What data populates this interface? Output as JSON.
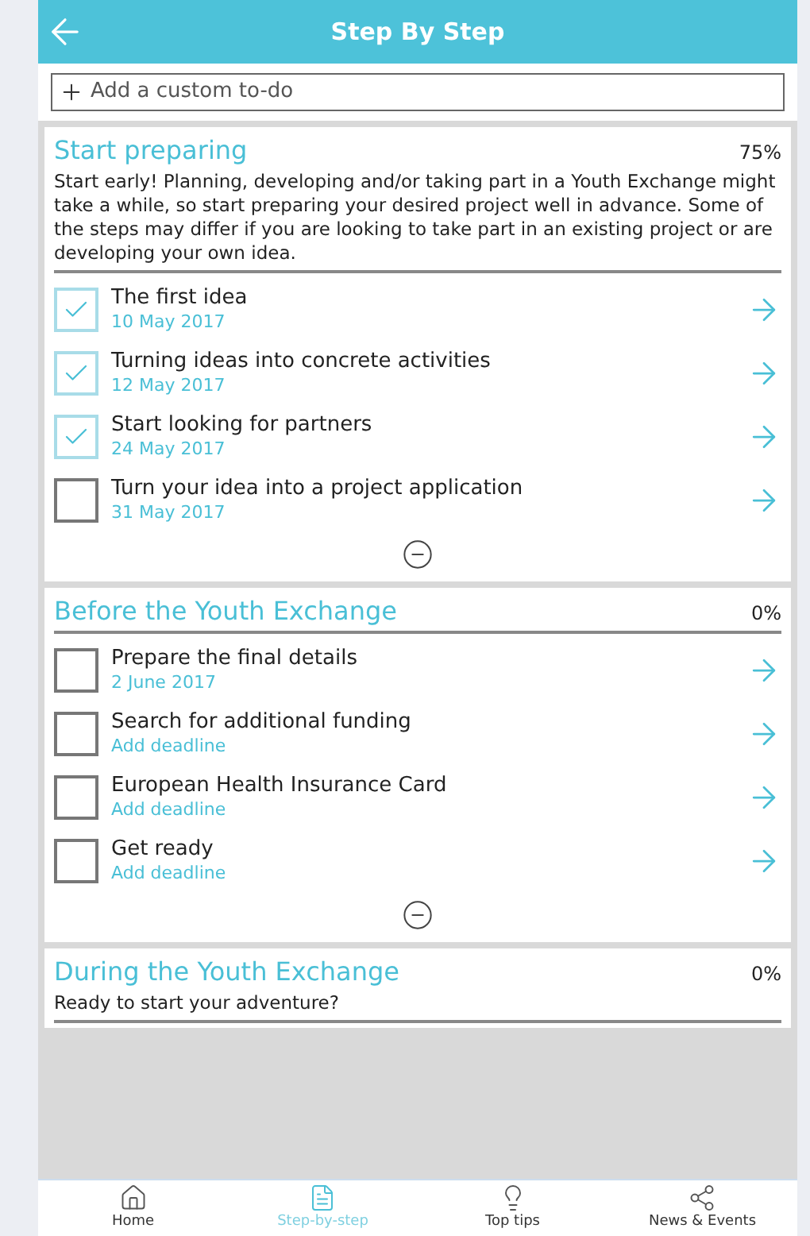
{
  "header": {
    "title": "Step By Step"
  },
  "add_field": {
    "placeholder": "Add a custom to-do"
  },
  "sections": [
    {
      "title": "Start preparing",
      "percent": "75%",
      "description": "Start early! Planning, developing and/or taking part in a Youth Exchange might take a while, so start preparing your desired project well in advance. Some of the steps may differ if you are looking to take part in an existing project or are developing your own idea.",
      "items": [
        {
          "title": "The first idea",
          "deadline": "10 May 2017",
          "checked": true
        },
        {
          "title": "Turning ideas into concrete activities",
          "deadline": "12 May 2017",
          "checked": true
        },
        {
          "title": "Start looking for partners",
          "deadline": "24 May 2017",
          "checked": true
        },
        {
          "title": "Turn your idea into a project application",
          "deadline": "31 May 2017",
          "checked": false
        }
      ]
    },
    {
      "title": "Before the Youth Exchange",
      "percent": "0%",
      "items": [
        {
          "title": "Prepare the final details",
          "deadline": "2 June 2017",
          "checked": false
        },
        {
          "title": "Search for additional funding",
          "deadline": "Add deadline",
          "checked": false
        },
        {
          "title": "European Health Insurance Card",
          "deadline": "Add deadline",
          "checked": false
        },
        {
          "title": "Get ready",
          "deadline": "Add deadline",
          "checked": false
        }
      ]
    },
    {
      "title": "During the Youth Exchange",
      "percent": "0%",
      "description": "Ready to start your adventure?"
    }
  ],
  "nav": [
    {
      "kind": "home",
      "label": "Home",
      "selected": false
    },
    {
      "kind": "steps",
      "label": "Step-by-step",
      "selected": true
    },
    {
      "kind": "tips",
      "label": "Top tips",
      "selected": false
    },
    {
      "kind": "news",
      "label": "News & Events",
      "selected": false
    }
  ]
}
